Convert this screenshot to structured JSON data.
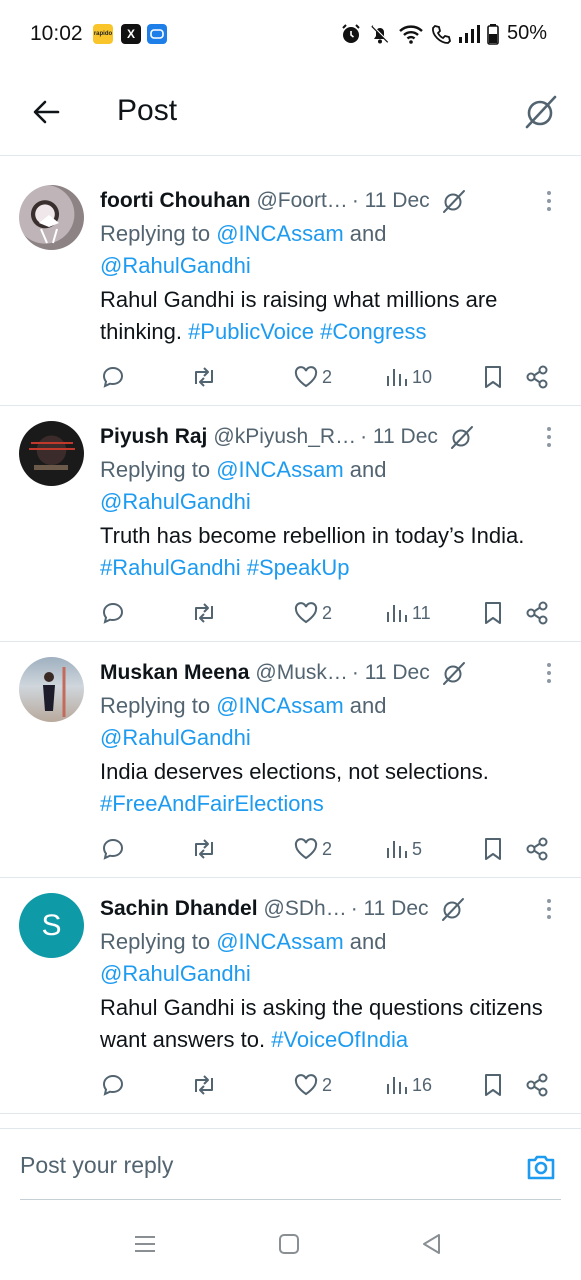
{
  "status_bar": {
    "time": "10:02",
    "apps": [
      "rapido",
      "X",
      "msg"
    ],
    "battery": "50%"
  },
  "header": {
    "title": "Post"
  },
  "tweets": [
    {
      "name": "foorti Chouhan",
      "handle": "@Foort…",
      "date": "· 11 Dec",
      "reply_prefix": "Replying to ",
      "reply_mention1": "@INCAssam",
      "reply_and": " and ",
      "reply_mention2": "@RahulGandhi",
      "text": "Rahul Gandhi is raising what millions are thinking. ",
      "hashtags": "#PublicVoice #Congress",
      "likes": "2",
      "views": "10"
    },
    {
      "name": "Piyush Raj",
      "handle": "@kPiyush_R…",
      "date": "· 11 Dec",
      "reply_prefix": "Replying to ",
      "reply_mention1": "@INCAssam",
      "reply_and": " and ",
      "reply_mention2": "@RahulGandhi",
      "text": "Truth has become rebellion in today’s India. ",
      "hashtags": "#RahulGandhi #SpeakUp",
      "likes": "2",
      "views": "11"
    },
    {
      "name": "Muskan Meena",
      "handle": "@Musk…",
      "date": "· 11 Dec",
      "reply_prefix": "Replying to ",
      "reply_mention1": "@INCAssam",
      "reply_and": " and ",
      "reply_mention2": "@RahulGandhi",
      "text": "India deserves elections, not selections. ",
      "hashtags": "#FreeAndFairElections",
      "likes": "2",
      "views": "5"
    },
    {
      "name": "Sachin Dhandel",
      "handle": "@SDh…",
      "date": "· 11 Dec",
      "avatar_letter": "S",
      "reply_prefix": "Replying to ",
      "reply_mention1": "@INCAssam",
      "reply_and": " and ",
      "reply_mention2": "@RahulGandhi",
      "text": "Rahul Gandhi is asking the questions citizens want answers to. ",
      "hashtags": "#VoiceOfIndia",
      "likes": "2",
      "views": "16"
    }
  ],
  "reply_box": {
    "placeholder": "Post your reply"
  },
  "icons": {
    "back": "arrow-left-icon",
    "grok": "grok-icon",
    "more": "more-vertical-icon",
    "reply": "reply-icon",
    "retweet": "retweet-icon",
    "like": "heart-icon",
    "views": "views-icon",
    "bookmark": "bookmark-icon",
    "share": "share-icon",
    "camera": "camera-icon"
  },
  "colors": {
    "link": "#1d9bf0",
    "muted": "#536471",
    "text": "#0f1419",
    "avatar_s": "#0e9aa7"
  }
}
